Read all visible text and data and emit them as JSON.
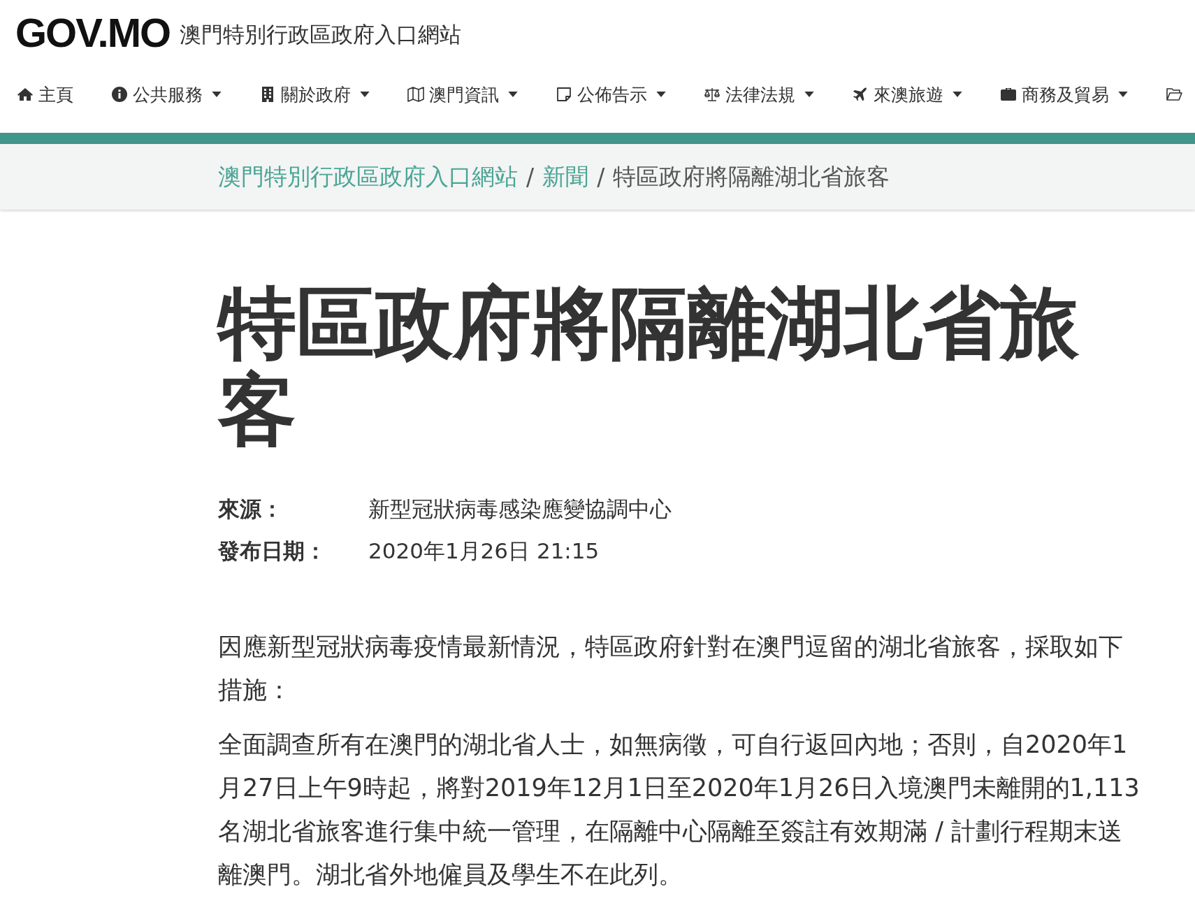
{
  "header": {
    "logo": "GOV.MO",
    "site_title": "澳門特別行政區政府入口網站"
  },
  "nav": [
    {
      "kind": "home",
      "label": "主頁",
      "dropdown": false
    },
    {
      "kind": "info",
      "label": "公共服務",
      "dropdown": true
    },
    {
      "kind": "building",
      "label": "關於政府",
      "dropdown": true
    },
    {
      "kind": "map",
      "label": "澳門資訊",
      "dropdown": true
    },
    {
      "kind": "note",
      "label": "公佈告示",
      "dropdown": true
    },
    {
      "kind": "scale",
      "label": "法律法規",
      "dropdown": true
    },
    {
      "kind": "plane",
      "label": "來澳旅遊",
      "dropdown": true
    },
    {
      "kind": "briefcase",
      "label": "商務及貿易",
      "dropdown": true
    },
    {
      "kind": "folder",
      "dropdown": false
    }
  ],
  "breadcrumb": [
    {
      "label": "澳門特別行政區政府入口網站",
      "link": true
    },
    {
      "separator": "/",
      "label": "新聞",
      "link": true
    },
    {
      "separator": "/",
      "label": "特區政府將隔離湖北省旅客",
      "link": false
    }
  ],
  "article": {
    "title": "特區政府將隔離湖北省旅客",
    "meta": [
      {
        "label": "來源：",
        "value": "新型冠狀病毒感染應變協調中心"
      },
      {
        "label": "發布日期：",
        "value": "2020年1月26日 21:15"
      }
    ],
    "paragraphs": [
      "因應新型冠狀病毒疫情最新情況，特區政府針對在澳門逗留的湖北省旅客，採取如下措施：",
      "全面調查所有在澳門的湖北省人士，如無病徵，可自行返回內地；否則，自2020年1月27日上午9時起，將對2019年12月1日至2020年1月26日入境澳門未離開的1,113名湖北省旅客進行集中統一管理，在隔離中心隔離至簽註有效期滿 / 計劃行程期末送離澳門。湖北省外地僱員及學生不在此列。"
    ]
  }
}
